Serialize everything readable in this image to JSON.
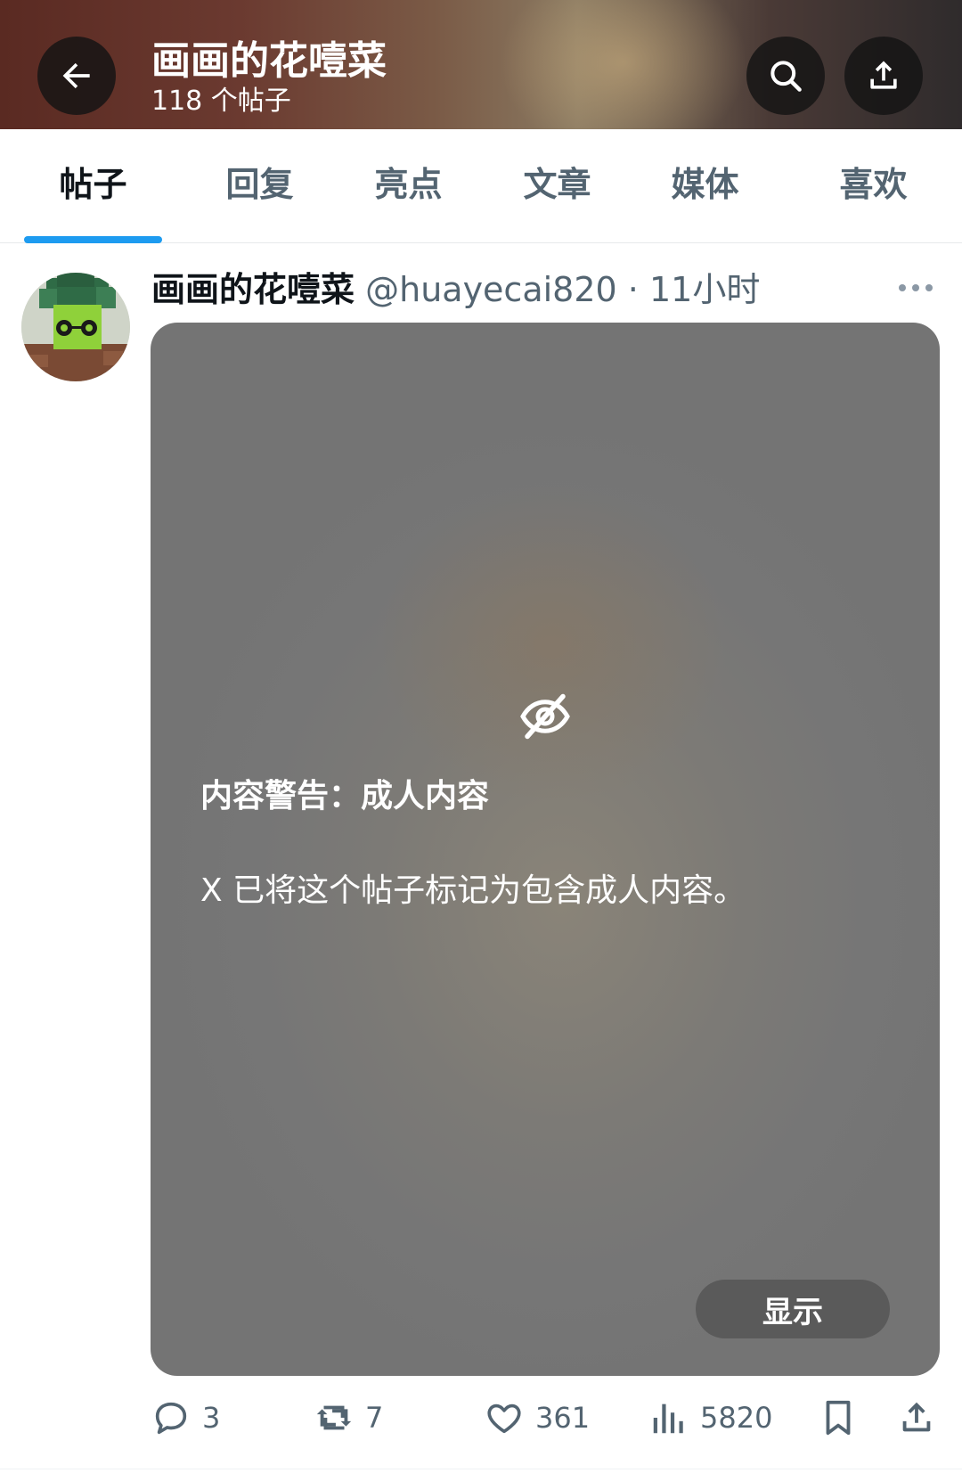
{
  "header": {
    "display_name": "画画的花噎菜",
    "post_count": "118 个帖子"
  },
  "tabs": [
    {
      "label": "帖子",
      "active": true
    },
    {
      "label": "回复",
      "active": false
    },
    {
      "label": "亮点",
      "active": false
    },
    {
      "label": "文章",
      "active": false
    },
    {
      "label": "媒体",
      "active": false
    },
    {
      "label": "喜欢",
      "active": false
    }
  ],
  "post": {
    "display_name": "画画的花噎菜",
    "handle": "@huayecai820",
    "separator": "·",
    "time": "11小时",
    "warning_title": "内容警告：成人内容",
    "warning_text": "X 已将这个帖子标记为包含成人内容。",
    "show_label": "显示",
    "replies": "3",
    "reposts": "7",
    "likes": "361",
    "views": "5820"
  },
  "colors": {
    "accent": "#1d9bf0",
    "secondary_text": "#536471"
  },
  "icons": [
    "back-arrow-icon",
    "search-icon",
    "share-icon",
    "more-icon",
    "eye-slash-icon",
    "reply-icon",
    "repost-icon",
    "like-icon",
    "views-icon",
    "bookmark-icon",
    "share-icon"
  ]
}
